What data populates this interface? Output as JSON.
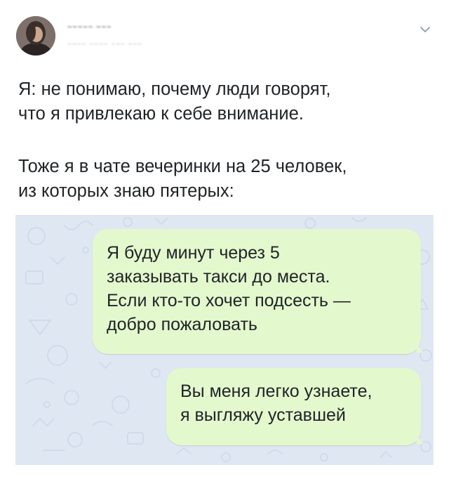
{
  "tweet": {
    "author_name_blurred": "~~~~~ ~~~",
    "author_handle_blurred": "~~~~ ~~~~ ~~~ ~~~",
    "paragraphs": [
      "Я: не понимаю, почему люди говорят,\nчто я привлекаю к себе внимание.",
      "Тоже я в чате вечеринки на 25 человек,\nиз которых знаю пятерых:"
    ]
  },
  "chat": {
    "messages": [
      {
        "text": "Я буду минут через 5\nзаказывать такси до места.\nЕсли кто-то хочет подсесть —\nдобро пожаловать"
      },
      {
        "text": "Вы меня легко узнаете,\nя выгляжу уставшей"
      }
    ],
    "bubble_color": "#e4f8ce",
    "background_color": "#dfe7f3"
  },
  "icons": {
    "avatar": "avatar-photo",
    "menu": "chevron-down-icon",
    "chat_wallpaper": "doodle-pattern"
  }
}
